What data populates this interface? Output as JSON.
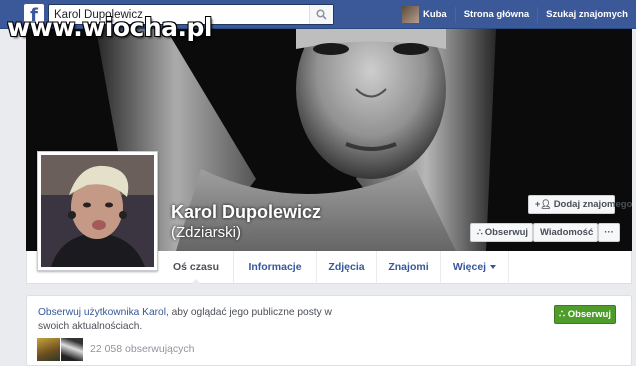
{
  "watermark": "www.wiocha.pl",
  "topbar": {
    "logo": "f",
    "search_value": "Karol Dupolewicz",
    "user_name": "Kuba",
    "home": "Strona główna",
    "find_friends": "Szukaj znajomych"
  },
  "profile": {
    "name": "Karol Dupolewicz",
    "alternate_name": "(Zdziarski)"
  },
  "actions": {
    "add_friend": "Dodaj znajomego",
    "follow": "Obserwuj",
    "message": "Wiadomość",
    "more": "···"
  },
  "tabs": [
    "Oś czasu",
    "Informacje",
    "Zdjęcia",
    "Znajomi",
    "Więcej"
  ],
  "follow_panel": {
    "link_text": "Obserwuj użytkownika Karol,",
    "rest_text": " aby oglądać jego publiczne posty w swoich aktualnościach.",
    "button": "Obserwuj",
    "followers": "22 058 obserwujących"
  },
  "icons": {
    "search": "search-icon",
    "add_friend": "add-friend-icon",
    "follow": "rss-icon",
    "more": "more-icon",
    "dropdown": "chevron-down-icon"
  },
  "colors": {
    "brand": "#3b5998",
    "link": "#365899",
    "follow_green": "#4e9d2b",
    "page_bg": "#e9ebee"
  }
}
